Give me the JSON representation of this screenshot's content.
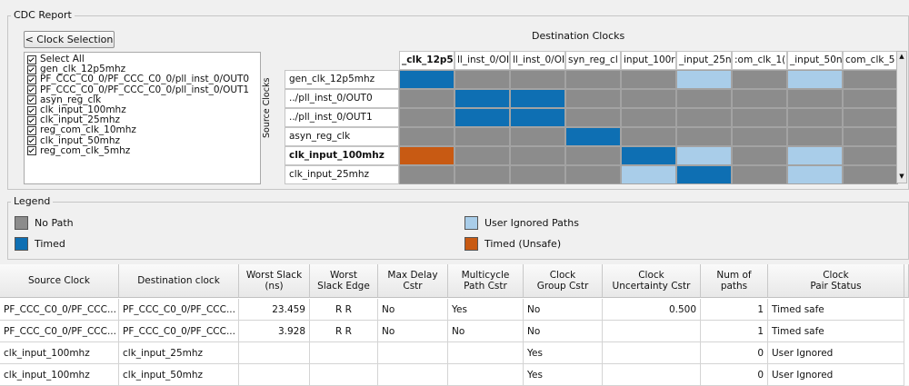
{
  "report": {
    "title": "CDC Report",
    "back_button": "< Clock Selection",
    "clock_list": [
      {
        "label": "Select All",
        "checked": true
      },
      {
        "label": "gen_clk_12p5mhz",
        "checked": true
      },
      {
        "label": "PF_CCC_C0_0/PF_CCC_C0_0/pll_inst_0/OUT0",
        "checked": true
      },
      {
        "label": "PF_CCC_C0_0/PF_CCC_C0_0/pll_inst_0/OUT1",
        "checked": true
      },
      {
        "label": "asyn_reg_clk",
        "checked": true
      },
      {
        "label": "clk_input_100mhz",
        "checked": true
      },
      {
        "label": "clk_input_25mhz",
        "checked": true
      },
      {
        "label": "reg_com_clk_10mhz",
        "checked": true
      },
      {
        "label": "clk_input_50mhz",
        "checked": true
      },
      {
        "label": "reg_com_clk_5mhz",
        "checked": true
      }
    ],
    "destination_title": "Destination Clocks",
    "source_title": "Source Clocks"
  },
  "colors": {
    "no_path": "#8c8c8c",
    "timed": "#0e6fb3",
    "user_ignored": "#a9cde9",
    "timed_unsafe": "#c85a13"
  },
  "matrix": {
    "columns": [
      "_clk_12p5",
      "ll_inst_0/OI",
      "ll_inst_0/OI",
      "syn_reg_cl",
      "input_100r",
      "_input_25n",
      ":om_clk_1(",
      "_input_50n",
      "com_clk_5"
    ],
    "rows": [
      {
        "label": "gen_clk_12p5mhz",
        "bold": false,
        "cells": [
          "T",
          "N",
          "N",
          "N",
          "N",
          "U",
          "N",
          "U",
          "N"
        ]
      },
      {
        "label": "../pll_inst_0/OUT0",
        "bold": false,
        "cells": [
          "N",
          "T",
          "T",
          "N",
          "N",
          "N",
          "N",
          "N",
          "N"
        ]
      },
      {
        "label": "../pll_inst_0/OUT1",
        "bold": false,
        "cells": [
          "N",
          "T",
          "T",
          "N",
          "N",
          "N",
          "N",
          "N",
          "N"
        ]
      },
      {
        "label": "asyn_reg_clk",
        "bold": false,
        "cells": [
          "N",
          "N",
          "N",
          "T",
          "N",
          "N",
          "N",
          "N",
          "N"
        ]
      },
      {
        "label": "clk_input_100mhz",
        "bold": true,
        "cells": [
          "X",
          "N",
          "N",
          "N",
          "T",
          "U",
          "N",
          "U",
          "N"
        ]
      },
      {
        "label": "clk_input_25mhz",
        "bold": false,
        "cells": [
          "N",
          "N",
          "N",
          "N",
          "U",
          "T",
          "N",
          "U",
          "N"
        ]
      }
    ]
  },
  "legend": {
    "title": "Legend",
    "items": [
      {
        "label": "No Path",
        "key": "no_path"
      },
      {
        "label": "Timed",
        "key": "timed"
      },
      {
        "label": "User Ignored Paths",
        "key": "user_ignored"
      },
      {
        "label": "Timed (Unsafe)",
        "key": "timed_unsafe"
      }
    ]
  },
  "table": {
    "headers": [
      "Source Clock",
      "Destination clock",
      "Worst Slack\n(ns)",
      "Worst\nSlack Edge",
      "Max Delay\nCstr",
      "Multicycle\nPath Cstr",
      "Clock\nGroup Cstr",
      "Clock\nUncertainty Cstr",
      "Num of\npaths",
      "Clock\nPair Status"
    ],
    "rows": [
      [
        "PF_CCC_C0_0/PF_CCC...",
        "PF_CCC_C0_0/PF_CCC...",
        "23.459",
        "R R",
        "No",
        "Yes",
        "No",
        "0.500",
        "1",
        "Timed safe"
      ],
      [
        "PF_CCC_C0_0/PF_CCC...",
        "PF_CCC_C0_0/PF_CCC...",
        "3.928",
        "R R",
        "No",
        "No",
        "No",
        "",
        "1",
        "Timed safe"
      ],
      [
        "clk_input_100mhz",
        "clk_input_25mhz",
        "",
        "",
        "",
        "",
        "Yes",
        "",
        "0",
        "User Ignored"
      ],
      [
        "clk_input_100mhz",
        "clk_input_50mhz",
        "",
        "",
        "",
        "",
        "Yes",
        "",
        "0",
        "User Ignored"
      ]
    ]
  }
}
